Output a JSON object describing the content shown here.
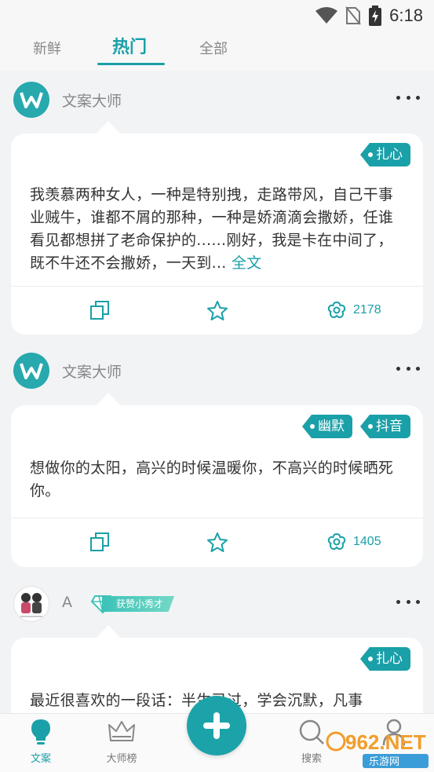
{
  "status_bar": {
    "time": "6:18",
    "icons": [
      "wifi-icon",
      "no-sim-icon",
      "battery-charging-icon"
    ]
  },
  "tabs": [
    {
      "label": "新鲜",
      "active": false
    },
    {
      "label": "热门",
      "active": true
    },
    {
      "label": "全部",
      "active": false
    }
  ],
  "posts": [
    {
      "author": "文案大师",
      "tags": [
        "扎心"
      ],
      "text": "我羡慕两种女人，一种是特别拽，走路带风，自己干事业贼牛，谁都不屑的那种，一种是娇滴滴会撒娇，任谁看见都想拼了老命保护的......刚好，我是卡在中间了，既不牛还不会撒娇，一天到...",
      "full_link": "全文",
      "like_count": "2178"
    },
    {
      "author": "文案大师",
      "tags": [
        "幽默",
        "抖音"
      ],
      "text": "想做你的太阳，高兴的时候温暖你，不高兴的时候晒死你。",
      "like_count": "1405"
    },
    {
      "author": "A",
      "badge": "获赞小秀才",
      "tags": [
        "扎心"
      ],
      "text": "最近很喜欢的一段话：半生已过，学会沉默，凡事"
    }
  ],
  "bottom_nav": [
    {
      "label": "文案",
      "icon": "lightbulb-icon",
      "active": true
    },
    {
      "label": "大师榜",
      "icon": "crown-icon",
      "active": false
    },
    {
      "label": "搜索",
      "icon": "search-icon",
      "active": false
    },
    {
      "label": "",
      "icon": "user-icon",
      "active": false
    }
  ],
  "watermark": {
    "site": "962.NET",
    "name": "乐游网"
  },
  "colors": {
    "accent": "#1aa0a8",
    "background": "#f2f3f5"
  }
}
